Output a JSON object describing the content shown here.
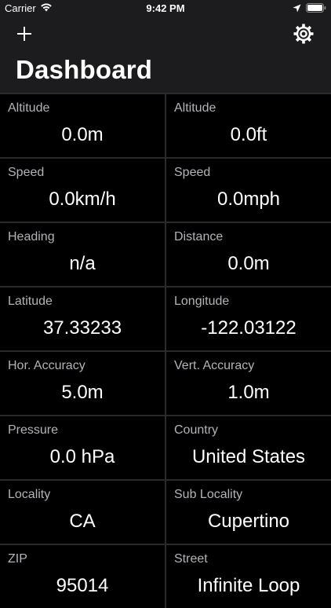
{
  "status_bar": {
    "carrier": "Carrier",
    "time": "9:42 PM"
  },
  "nav": {
    "title": "Dashboard",
    "add_icon": "plus-icon",
    "settings_icon": "gear-icon"
  },
  "tiles": [
    {
      "label": "Altitude",
      "value": "0.0m"
    },
    {
      "label": "Altitude",
      "value": "0.0ft"
    },
    {
      "label": "Speed",
      "value": "0.0km/h"
    },
    {
      "label": "Speed",
      "value": "0.0mph"
    },
    {
      "label": "Heading",
      "value": "n/a"
    },
    {
      "label": "Distance",
      "value": "0.0m"
    },
    {
      "label": "Latitude",
      "value": "37.33233"
    },
    {
      "label": "Longitude",
      "value": "-122.03122"
    },
    {
      "label": "Hor. Accuracy",
      "value": "5.0m"
    },
    {
      "label": "Vert. Accuracy",
      "value": "1.0m"
    },
    {
      "label": "Pressure",
      "value": "0.0 hPa"
    },
    {
      "label": "Country",
      "value": "United States"
    },
    {
      "label": "Locality",
      "value": "CA"
    },
    {
      "label": "Sub Locality",
      "value": "Cupertino"
    },
    {
      "label": "ZIP",
      "value": "95014"
    },
    {
      "label": "Street",
      "value": "Infinite Loop"
    }
  ],
  "colors": {
    "background": "#000000",
    "bar": "#1c1c1e",
    "label": "#b3b3b8",
    "value": "#ffffff",
    "divider": "#2a2a2c"
  }
}
